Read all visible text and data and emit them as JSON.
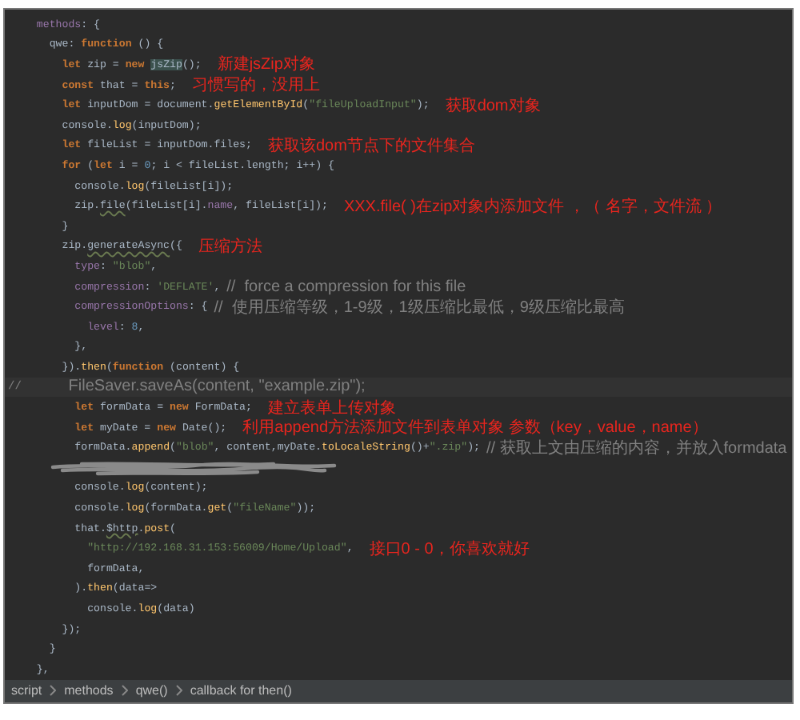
{
  "editor": {
    "lines": [
      {
        "kind": "code",
        "segments": [
          {
            "kind": "prop",
            "text": "  methods"
          },
          {
            "kind": "plain",
            "text": ": {"
          }
        ]
      },
      {
        "kind": "code",
        "segments": [
          {
            "kind": "plain",
            "text": "    qwe: "
          },
          {
            "kind": "kw",
            "text": "function"
          },
          {
            "kind": "plain",
            "text": " () {"
          }
        ]
      },
      {
        "kind": "code",
        "segments": [
          {
            "kind": "kw",
            "text": "      let"
          },
          {
            "kind": "plain",
            "text": " zip = "
          },
          {
            "kind": "kw",
            "text": "new "
          },
          {
            "kind": "match",
            "text": "jsZip"
          },
          {
            "kind": "plain",
            "text": "();"
          }
        ],
        "note": "新建jsZip对象"
      },
      {
        "kind": "code",
        "segments": [
          {
            "kind": "kw",
            "text": "      const"
          },
          {
            "kind": "plain",
            "text": " that = "
          },
          {
            "kind": "kw",
            "text": "this"
          },
          {
            "kind": "plain",
            "text": ";"
          }
        ],
        "note": "习惯写的，没用上"
      },
      {
        "kind": "code",
        "segments": [
          {
            "kind": "kw",
            "text": "      let"
          },
          {
            "kind": "plain",
            "text": " inputDom = document."
          },
          {
            "kind": "fn",
            "text": "getElementById"
          },
          {
            "kind": "plain",
            "text": "("
          },
          {
            "kind": "str",
            "text": "\"fileUploadInput\""
          },
          {
            "kind": "plain",
            "text": ");"
          }
        ],
        "note": "获取dom对象"
      },
      {
        "kind": "code",
        "segments": [
          {
            "kind": "plain",
            "text": "      console."
          },
          {
            "kind": "fn",
            "text": "log"
          },
          {
            "kind": "plain",
            "text": "(inputDom);"
          }
        ]
      },
      {
        "kind": "code",
        "segments": [
          {
            "kind": "kw",
            "text": "      let"
          },
          {
            "kind": "plain",
            "text": " fileList = inputDom.files;"
          }
        ],
        "note": "获取该dom节点下的文件集合"
      },
      {
        "kind": "code",
        "segments": [
          {
            "kind": "kw",
            "text": "      for"
          },
          {
            "kind": "plain",
            "text": " ("
          },
          {
            "kind": "kw",
            "text": "let"
          },
          {
            "kind": "plain",
            "text": " i = "
          },
          {
            "kind": "num",
            "text": "0"
          },
          {
            "kind": "plain",
            "text": "; i < fileList.length; i++) {"
          }
        ]
      },
      {
        "kind": "code",
        "segments": [
          {
            "kind": "plain",
            "text": "        console."
          },
          {
            "kind": "fn",
            "text": "log"
          },
          {
            "kind": "plain",
            "text": "(fileList[i]);"
          }
        ]
      },
      {
        "kind": "code",
        "segments": [
          {
            "kind": "plain",
            "text": "        zip."
          },
          {
            "kind": "warn",
            "text": "file"
          },
          {
            "kind": "plain",
            "text": "(fileList[i]."
          },
          {
            "kind": "prop",
            "text": "name"
          },
          {
            "kind": "plain",
            "text": ", fileList[i]);"
          }
        ],
        "note": "XXX.file( )在zip对象内添加文件 ，（ 名字，文件流 ）"
      },
      {
        "kind": "code",
        "segments": [
          {
            "kind": "plain",
            "text": "      }"
          }
        ]
      },
      {
        "kind": "code",
        "segments": [
          {
            "kind": "plain",
            "text": "      zip."
          },
          {
            "kind": "warn",
            "text": "generateAsync"
          },
          {
            "kind": "plain",
            "text": "({"
          }
        ],
        "note": "压缩方法"
      },
      {
        "kind": "code",
        "segments": [
          {
            "kind": "prop",
            "text": "        type"
          },
          {
            "kind": "plain",
            "text": ": "
          },
          {
            "kind": "str",
            "text": "\"blob\""
          },
          {
            "kind": "plain",
            "text": ","
          }
        ]
      },
      {
        "kind": "code",
        "segments": [
          {
            "kind": "prop",
            "text": "        compression"
          },
          {
            "kind": "plain",
            "text": ": "
          },
          {
            "kind": "str",
            "text": "'DEFLATE'"
          },
          {
            "kind": "plain",
            "text": ", "
          },
          {
            "kind": "comment",
            "text": "//  force a compression for this file"
          }
        ]
      },
      {
        "kind": "code",
        "segments": [
          {
            "kind": "prop",
            "text": "        compressionOptions"
          },
          {
            "kind": "plain",
            "text": ": { "
          },
          {
            "kind": "comment",
            "text": "//  使用压缩等级，1-9级，1级压缩比最低，9级压缩比最高"
          }
        ]
      },
      {
        "kind": "code",
        "segments": [
          {
            "kind": "prop",
            "text": "          level"
          },
          {
            "kind": "plain",
            "text": ": "
          },
          {
            "kind": "num",
            "text": "8"
          },
          {
            "kind": "plain",
            "text": ","
          }
        ]
      },
      {
        "kind": "code",
        "segments": [
          {
            "kind": "plain",
            "text": "        },"
          }
        ]
      },
      {
        "kind": "code",
        "segments": [
          {
            "kind": "plain",
            "text": "      })."
          },
          {
            "kind": "fn",
            "text": "then"
          },
          {
            "kind": "plain",
            "text": "("
          },
          {
            "kind": "kw",
            "text": "function"
          },
          {
            "kind": "plain",
            "text": " (content) {"
          }
        ]
      },
      {
        "kind": "current",
        "gutter": "//",
        "segments": [
          {
            "kind": "comment",
            "text": "          FileSaver.saveAs(content, \"example.zip\");"
          }
        ]
      },
      {
        "kind": "code",
        "segments": [
          {
            "kind": "kw",
            "text": "        let"
          },
          {
            "kind": "plain",
            "text": " formData = "
          },
          {
            "kind": "kw",
            "text": "new"
          },
          {
            "kind": "plain",
            "text": " FormData;"
          }
        ],
        "note": "建立表单上传对象"
      },
      {
        "kind": "code",
        "segments": [
          {
            "kind": "kw",
            "text": "        let"
          },
          {
            "kind": "plain",
            "text": " myDate = "
          },
          {
            "kind": "kw",
            "text": "new"
          },
          {
            "kind": "plain",
            "text": " Date();"
          }
        ],
        "note": "利用append方法添加文件到表单对象 参数（key，value，name）"
      },
      {
        "kind": "code",
        "segments": [
          {
            "kind": "plain",
            "text": "        formData."
          },
          {
            "kind": "fn",
            "text": "append"
          },
          {
            "kind": "plain",
            "text": "("
          },
          {
            "kind": "str",
            "text": "\"blob\""
          },
          {
            "kind": "plain",
            "text": ", content,myDate."
          },
          {
            "kind": "fn",
            "text": "toLocaleString"
          },
          {
            "kind": "plain",
            "text": "()+"
          },
          {
            "kind": "str",
            "text": "\".zip\""
          },
          {
            "kind": "plain",
            "text": "); "
          },
          {
            "kind": "comment",
            "text": "// 获取上文由压缩的内容，并放入formdata"
          }
        ]
      },
      {
        "kind": "redacted"
      },
      {
        "kind": "code",
        "segments": [
          {
            "kind": "plain",
            "text": "        console."
          },
          {
            "kind": "fn",
            "text": "log"
          },
          {
            "kind": "plain",
            "text": "(content);"
          }
        ]
      },
      {
        "kind": "code",
        "segments": [
          {
            "kind": "plain",
            "text": "        console."
          },
          {
            "kind": "fn",
            "text": "log"
          },
          {
            "kind": "plain",
            "text": "(formData."
          },
          {
            "kind": "fn",
            "text": "get"
          },
          {
            "kind": "plain",
            "text": "("
          },
          {
            "kind": "str",
            "text": "\"fileName\""
          },
          {
            "kind": "plain",
            "text": "));"
          }
        ]
      },
      {
        "kind": "code",
        "segments": [
          {
            "kind": "plain",
            "text": "        that."
          },
          {
            "kind": "warn",
            "text": "$http"
          },
          {
            "kind": "plain",
            "text": "."
          },
          {
            "kind": "fn",
            "text": "post"
          },
          {
            "kind": "plain",
            "text": "("
          }
        ]
      },
      {
        "kind": "code",
        "segments": [
          {
            "kind": "str",
            "text": "          \"http://192.168.31.153:56009/Home/Upload\""
          },
          {
            "kind": "plain",
            "text": ","
          }
        ],
        "note": "接口0 - 0，你喜欢就好"
      },
      {
        "kind": "code",
        "segments": [
          {
            "kind": "plain",
            "text": "          formData,"
          }
        ]
      },
      {
        "kind": "code",
        "segments": [
          {
            "kind": "plain",
            "text": "        )."
          },
          {
            "kind": "fn",
            "text": "then"
          },
          {
            "kind": "plain",
            "text": "(data=>"
          }
        ]
      },
      {
        "kind": "code",
        "segments": [
          {
            "kind": "plain",
            "text": "          console."
          },
          {
            "kind": "fn",
            "text": "log"
          },
          {
            "kind": "plain",
            "text": "(data)"
          }
        ]
      },
      {
        "kind": "code",
        "segments": [
          {
            "kind": "plain",
            "text": "      })"
          },
          {
            "kind": "plain",
            "text": ";"
          }
        ]
      },
      {
        "kind": "code",
        "segments": [
          {
            "kind": "plain",
            "text": "    }"
          }
        ]
      },
      {
        "kind": "code",
        "segments": [
          {
            "kind": "plain",
            "text": "  },"
          }
        ]
      }
    ]
  },
  "breadcrumb": [
    "script",
    "methods",
    "qwe()",
    "callback for then()"
  ]
}
